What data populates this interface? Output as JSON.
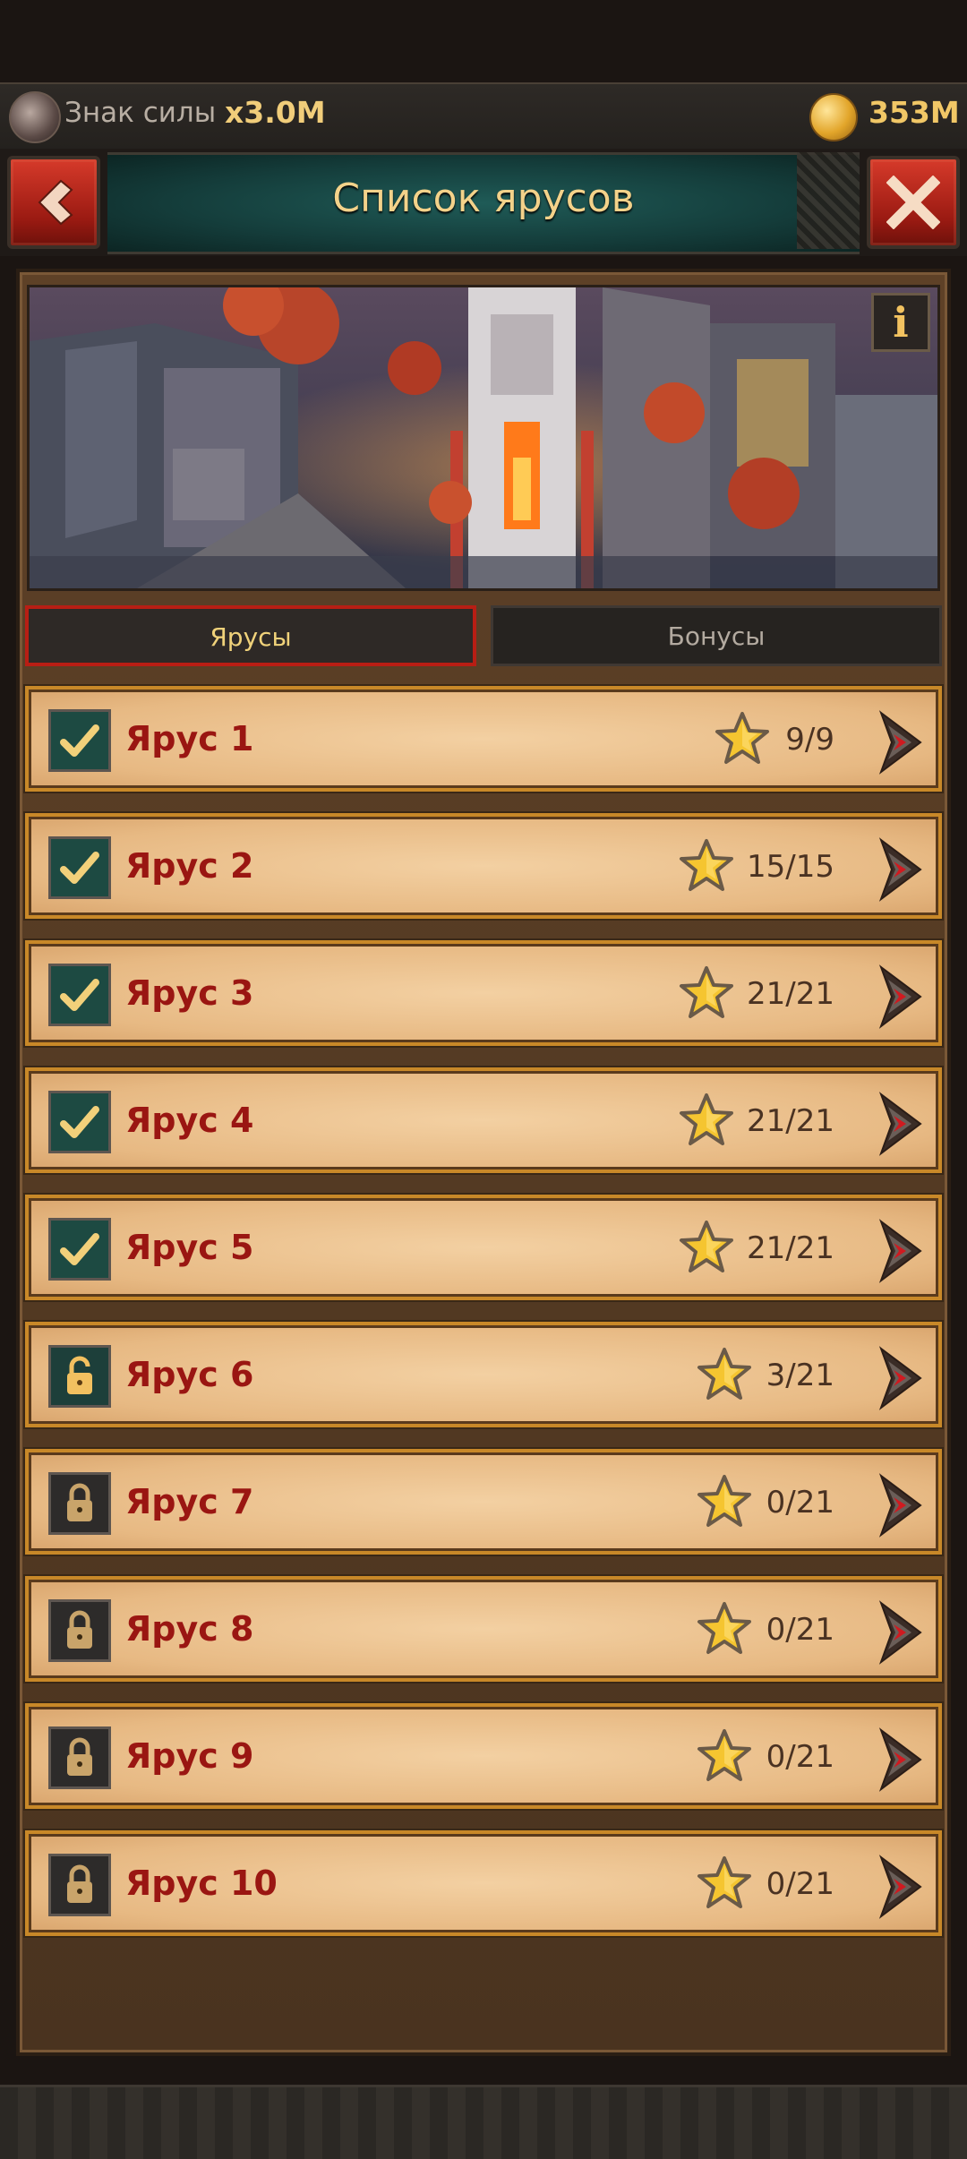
{
  "topbar": {
    "resource_label": "Знак силы",
    "resource_value": "x3.0M",
    "coins": "353M"
  },
  "header": {
    "title": "Список ярусов",
    "back_icon": "chevron-left-icon",
    "close_icon": "close-icon"
  },
  "banner": {
    "info_label": "i"
  },
  "tabs": [
    {
      "label": "Ярусы",
      "active": true
    },
    {
      "label": "Бонусы",
      "active": false
    }
  ],
  "tiers": [
    {
      "name": "Ярус 1",
      "stars": "9/9",
      "status": "completed"
    },
    {
      "name": "Ярус 2",
      "stars": "15/15",
      "status": "completed"
    },
    {
      "name": "Ярус 3",
      "stars": "21/21",
      "status": "completed"
    },
    {
      "name": "Ярус 4",
      "stars": "21/21",
      "status": "completed"
    },
    {
      "name": "Ярус 5",
      "stars": "21/21",
      "status": "completed"
    },
    {
      "name": "Ярус 6",
      "stars": "3/21",
      "status": "unlocked"
    },
    {
      "name": "Ярус 7",
      "stars": "0/21",
      "status": "locked"
    },
    {
      "name": "Ярус 8",
      "stars": "0/21",
      "status": "locked"
    },
    {
      "name": "Ярус 9",
      "stars": "0/21",
      "status": "locked"
    },
    {
      "name": "Ярус 10",
      "stars": "0/21",
      "status": "locked"
    }
  ],
  "colors": {
    "accent_red": "#b81e14",
    "gold": "#f1cd7a",
    "tier_name": "#9a1612",
    "row_border": "#c88828"
  }
}
